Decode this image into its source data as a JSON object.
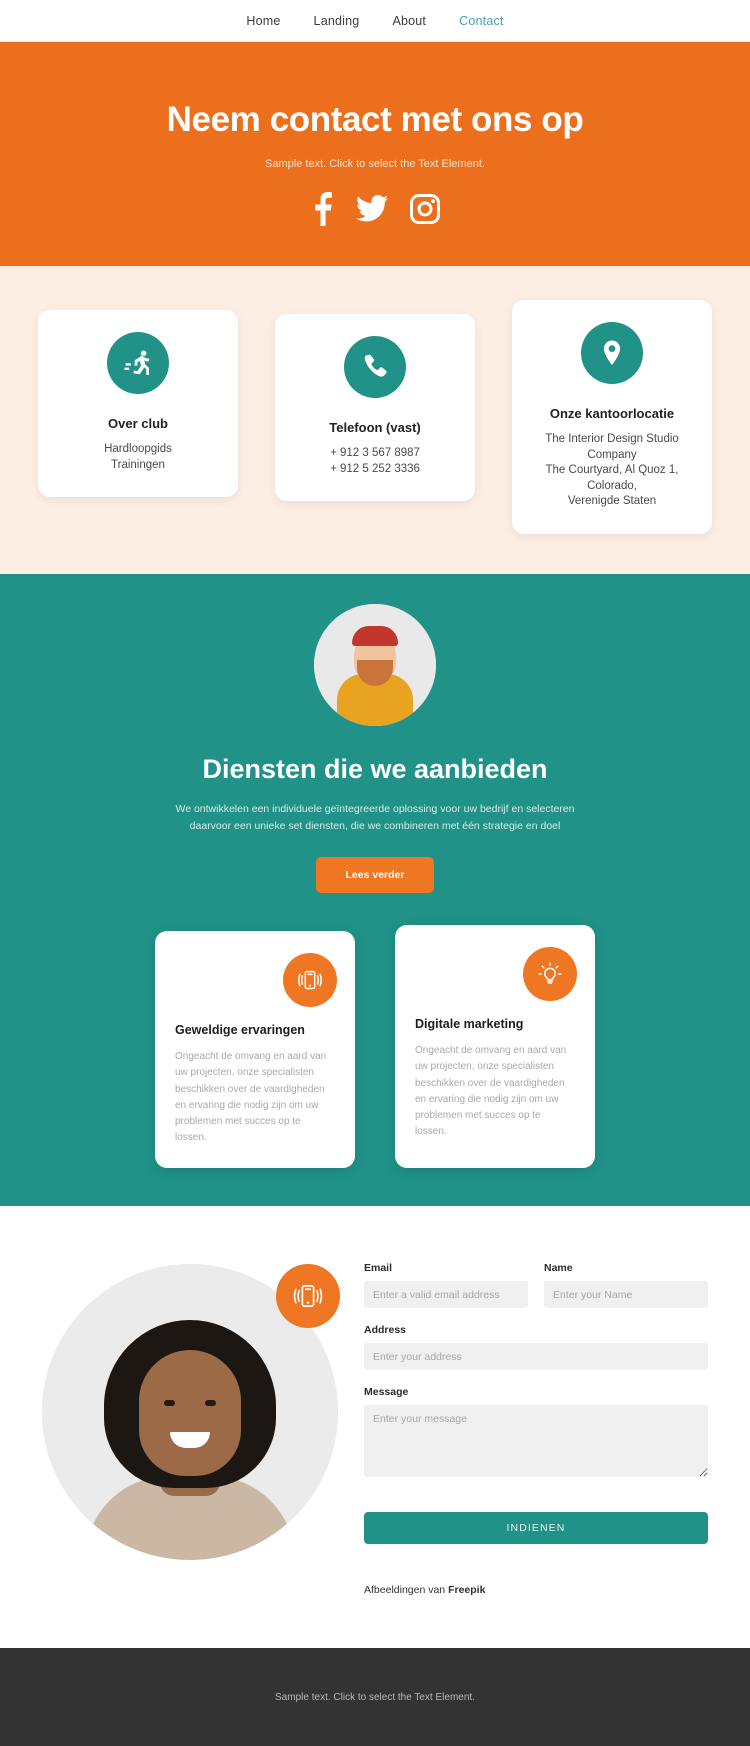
{
  "nav": {
    "items": [
      {
        "label": "Home",
        "active": false
      },
      {
        "label": "Landing",
        "active": false
      },
      {
        "label": "About",
        "active": false
      },
      {
        "label": "Contact",
        "active": true
      }
    ]
  },
  "hero": {
    "title": "Neem contact met ons op",
    "subtitle": "Sample text. Click to select the Text Element.",
    "background_color": "#ec6f1e",
    "socials": [
      {
        "name": "facebook-icon"
      },
      {
        "name": "twitter-icon"
      },
      {
        "name": "instagram-icon"
      }
    ]
  },
  "contact_cards": {
    "background_color": "#fdeee4",
    "icon_color": "#209288",
    "items": [
      {
        "icon": "running-icon",
        "title": "Over club",
        "lines": [
          "Hardloopgids",
          "Trainingen"
        ]
      },
      {
        "icon": "phone-icon",
        "title": "Telefoon (vast)",
        "lines": [
          "+ 912 3 567 8987",
          "+ 912 5 252 3336"
        ]
      },
      {
        "icon": "location-pin-icon",
        "title": "Onze kantoorlocatie",
        "lines": [
          "The Interior Design Studio Company",
          "The Courtyard, Al Quoz 1, Colorado,",
          "Verenigde Staten"
        ]
      }
    ]
  },
  "services": {
    "background_color": "#209288",
    "title": "Diensten die we aanbieden",
    "description": "We ontwikkelen een individuele geïntegreerde oplossing voor uw bedrijf en selecteren daarvoor een unieke set diensten, die we combineren met één strategie en doel",
    "button_label": "Lees verder",
    "button_color": "#ef7622",
    "cards": [
      {
        "icon": "mobile-vibrate-icon",
        "title": "Geweldige ervaringen",
        "body": "Ongeacht de omvang en aard van uw projecten, onze specialisten beschikken over de vaardigheden en ervaring die nodig zijn om uw problemen met succes op te lossen."
      },
      {
        "icon": "lightbulb-icon",
        "title": "Digitale marketing",
        "body": "Ongeacht de omvang en aard van uw projecten, onze specialisten beschikken over de vaardigheden en ervaring die nodig zijn om uw problemen met succes op te lossen."
      }
    ]
  },
  "form": {
    "badge_icon": "mobile-vibrate-icon",
    "fields": {
      "email": {
        "label": "Email",
        "placeholder": "Enter a valid email address",
        "value": ""
      },
      "name": {
        "label": "Name",
        "placeholder": "Enter your Name",
        "value": ""
      },
      "address": {
        "label": "Address",
        "placeholder": "Enter your address",
        "value": ""
      },
      "message": {
        "label": "Message",
        "placeholder": "Enter your message",
        "value": ""
      }
    },
    "submit_label": "INDIENEN",
    "submit_color": "#209288",
    "credit_prefix": "Afbeeldingen van ",
    "credit_brand": "Freepik"
  },
  "footer": {
    "text": "Sample text. Click to select the Text Element.",
    "background_color": "#333333"
  }
}
